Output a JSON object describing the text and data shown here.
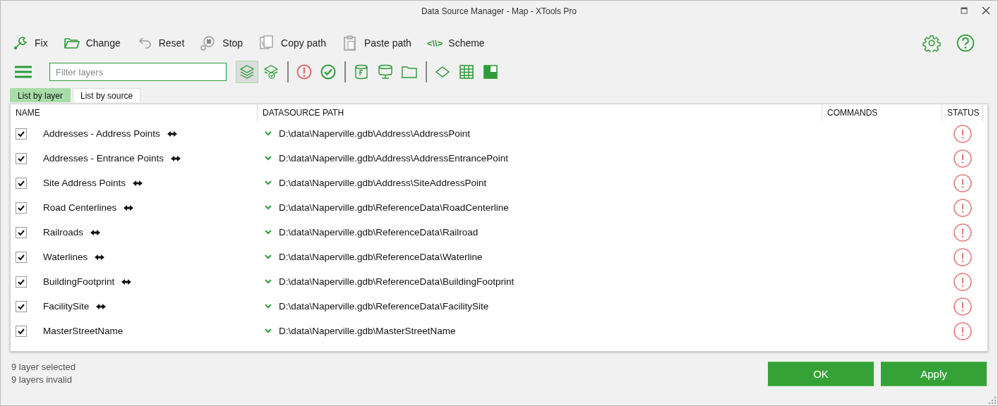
{
  "window": {
    "title": "Data Source Manager - Map  -  XTools Pro"
  },
  "toolbar": [
    {
      "kind": "fix",
      "label": "Fix"
    },
    {
      "kind": "change",
      "label": "Change"
    },
    {
      "kind": "reset",
      "label": "Reset"
    },
    {
      "kind": "stop",
      "label": "Stop"
    },
    {
      "kind": "copy",
      "label": "Copy path"
    },
    {
      "kind": "paste",
      "label": "Paste path"
    },
    {
      "kind": "scheme",
      "glyph": "<\\\\>",
      "label": "Scheme"
    }
  ],
  "filter": {
    "placeholder": "Filter layers"
  },
  "filter_buttons": [
    {
      "kind": "layers",
      "selected": true
    },
    {
      "kind": "layers-check",
      "selected": false
    },
    {
      "kind": "sep"
    },
    {
      "kind": "error",
      "selected": false
    },
    {
      "kind": "ok",
      "selected": false
    },
    {
      "kind": "sep"
    },
    {
      "kind": "feature-db",
      "selected": false
    },
    {
      "kind": "db-monitor",
      "selected": false
    },
    {
      "kind": "folder",
      "selected": false
    },
    {
      "kind": "sep"
    },
    {
      "kind": "diamond",
      "selected": false
    },
    {
      "kind": "table",
      "selected": false
    },
    {
      "kind": "checker",
      "selected": false
    }
  ],
  "tabs": [
    {
      "label": "List by layer",
      "selected": true
    },
    {
      "label": "List by source",
      "selected": false
    }
  ],
  "table": {
    "columns": [
      "NAME",
      "DATASOURCE PATH",
      "COMMANDS",
      "STATUS"
    ],
    "rows": [
      {
        "checked": true,
        "name": "Addresses - Address Points",
        "move_mark": true,
        "path": "D:\\data\\Naperville.gdb\\Address\\AddressPoint",
        "invalid": true
      },
      {
        "checked": true,
        "name": "Addresses - Entrance Points",
        "move_mark": true,
        "path": "D:\\data\\Naperville.gdb\\Address\\AddressEntrancePoint",
        "invalid": true
      },
      {
        "checked": true,
        "name": "Site Address Points",
        "move_mark": true,
        "path": "D:\\data\\Naperville.gdb\\Address\\SiteAddressPoint",
        "invalid": true
      },
      {
        "checked": true,
        "name": "Road Centerlines",
        "move_mark": true,
        "path": "D:\\data\\Naperville.gdb\\ReferenceData\\RoadCenterline",
        "invalid": true
      },
      {
        "checked": true,
        "name": "Railroads",
        "move_mark": true,
        "path": "D:\\data\\Naperville.gdb\\ReferenceData\\Railroad",
        "invalid": true
      },
      {
        "checked": true,
        "name": "Waterlines",
        "move_mark": true,
        "path": "D:\\data\\Naperville.gdb\\ReferenceData\\Waterline",
        "invalid": true
      },
      {
        "checked": true,
        "name": "BuildingFootprint",
        "move_mark": true,
        "path": "D:\\data\\Naperville.gdb\\ReferenceData\\BuildingFootprint",
        "invalid": true
      },
      {
        "checked": true,
        "name": "FacilitySite",
        "move_mark": true,
        "path": "D:\\data\\Naperville.gdb\\ReferenceData\\FacilitySite",
        "invalid": true
      },
      {
        "checked": true,
        "name": "MasterStreetName",
        "move_mark": false,
        "path": "D:\\data\\Naperville.gdb\\MasterStreetName",
        "invalid": true
      }
    ]
  },
  "status_bar": [
    "9 layer selected",
    "9 layers invalid"
  ],
  "buttons": [
    "OK",
    "Apply"
  ]
}
